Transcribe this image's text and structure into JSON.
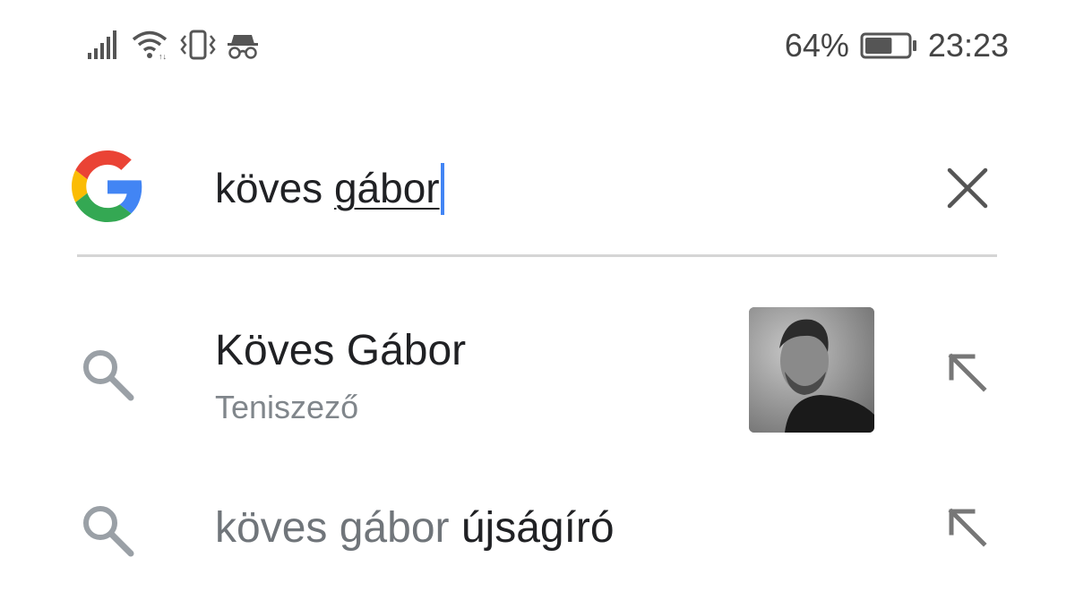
{
  "status_bar": {
    "icons": [
      "signal-icon",
      "wifi-icon",
      "vibrate-icon",
      "incognito-icon"
    ],
    "battery_percent": "64%",
    "battery_level": 0.64,
    "time": "23:23"
  },
  "search": {
    "query_typed": "köves ",
    "query_composing": "gábor",
    "logo": "google-g-logo",
    "clear_icon": "close-icon"
  },
  "suggestions": [
    {
      "title": "Köves Gábor",
      "subtitle": "Teniszező",
      "has_thumbnail": true,
      "icon": "search-icon",
      "action_icon": "arrow-up-left-icon"
    },
    {
      "title_prefix": "köves gábor ",
      "title_completion": "újságíró",
      "icon": "search-icon",
      "action_icon": "arrow-up-left-icon"
    }
  ],
  "colors": {
    "google_blue": "#4285F4",
    "google_red": "#EA4335",
    "google_yellow": "#FBBC05",
    "google_green": "#34A853",
    "cursor": "#4285F4",
    "secondary_text": "#80868B"
  }
}
